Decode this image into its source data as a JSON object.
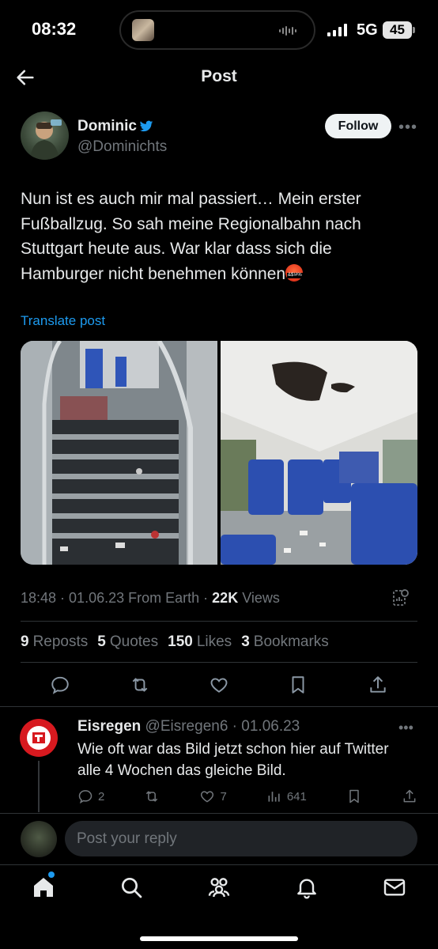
{
  "status": {
    "time": "08:32",
    "network": "5G",
    "battery": "45"
  },
  "header": {
    "title": "Post"
  },
  "author": {
    "name": "Dominic",
    "handle": "@Dominichts",
    "follow_label": "Follow",
    "verified_icon": "bird-icon"
  },
  "post": {
    "text": "Nun ist es auch mir mal passiert… Mein erster Fußballzug. So sah meine Regionalbahn nach Stuttgart heute aus. War klar dass sich die Hamburger nicht benehmen können",
    "translate_label": "Translate post",
    "time": "18:48",
    "date": "01.06.23",
    "source": "From Earth",
    "views_count": "22K",
    "views_label": "Views"
  },
  "stats": {
    "reposts": {
      "count": "9",
      "label": "Reposts"
    },
    "quotes": {
      "count": "5",
      "label": "Quotes"
    },
    "likes": {
      "count": "150",
      "label": "Likes"
    },
    "bookmarks": {
      "count": "3",
      "label": "Bookmarks"
    }
  },
  "reply": {
    "name": "Eisregen",
    "handle": "@Eisregen6",
    "date": "01.06.23",
    "text": "Wie oft war das Bild jetzt schon hier auf Twitter alle 4 Wochen das gleiche Bild.",
    "replies": "2",
    "likes": "7",
    "views": "641"
  },
  "composer": {
    "placeholder": "Post your reply"
  },
  "colors": {
    "accent": "#1d9bf0",
    "text": "#e7e9ea",
    "muted": "#71767b",
    "background": "#000000"
  }
}
